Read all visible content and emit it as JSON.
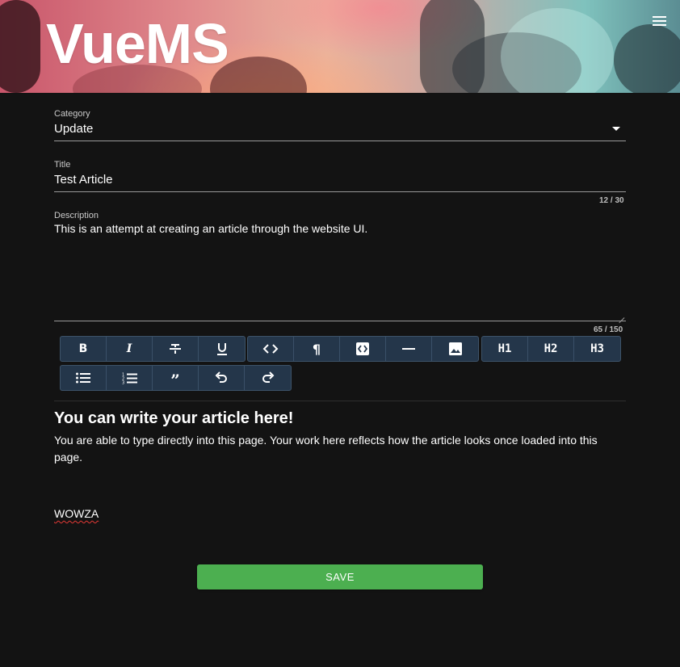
{
  "header": {
    "logo_text": "VueMS",
    "menu_icon": "hamburger-menu-icon"
  },
  "form": {
    "category": {
      "label": "Category",
      "value": "Update"
    },
    "title": {
      "label": "Title",
      "value": "Test Article",
      "counter": "12 / 30"
    },
    "description": {
      "label": "Description",
      "value": "This is an attempt at creating an article through the website UI.",
      "counter": "65 / 150"
    }
  },
  "toolbar": {
    "row1_group1": [
      "bold-icon",
      "italic-icon",
      "strikethrough-icon",
      "underline-icon"
    ],
    "row1_group2": [
      "code-icon",
      "paragraph-icon",
      "code-block-icon",
      "horizontal-rule-icon",
      "image-icon"
    ],
    "row1_group3": [
      "H1",
      "H2",
      "H3"
    ],
    "row2_group1": [
      "bullet-list-icon",
      "ordered-list-icon",
      "blockquote-icon",
      "undo-icon",
      "redo-icon"
    ]
  },
  "editor": {
    "heading": "You can write your article here!",
    "paragraph": "You are able to type directly into this page. Your work here reflects how the article looks once loaded into this page.",
    "word": "WOWZA"
  },
  "actions": {
    "save_label": "SAVE"
  },
  "colors": {
    "background": "#131313",
    "toolbar": "#24364a",
    "save": "#4caf50"
  }
}
